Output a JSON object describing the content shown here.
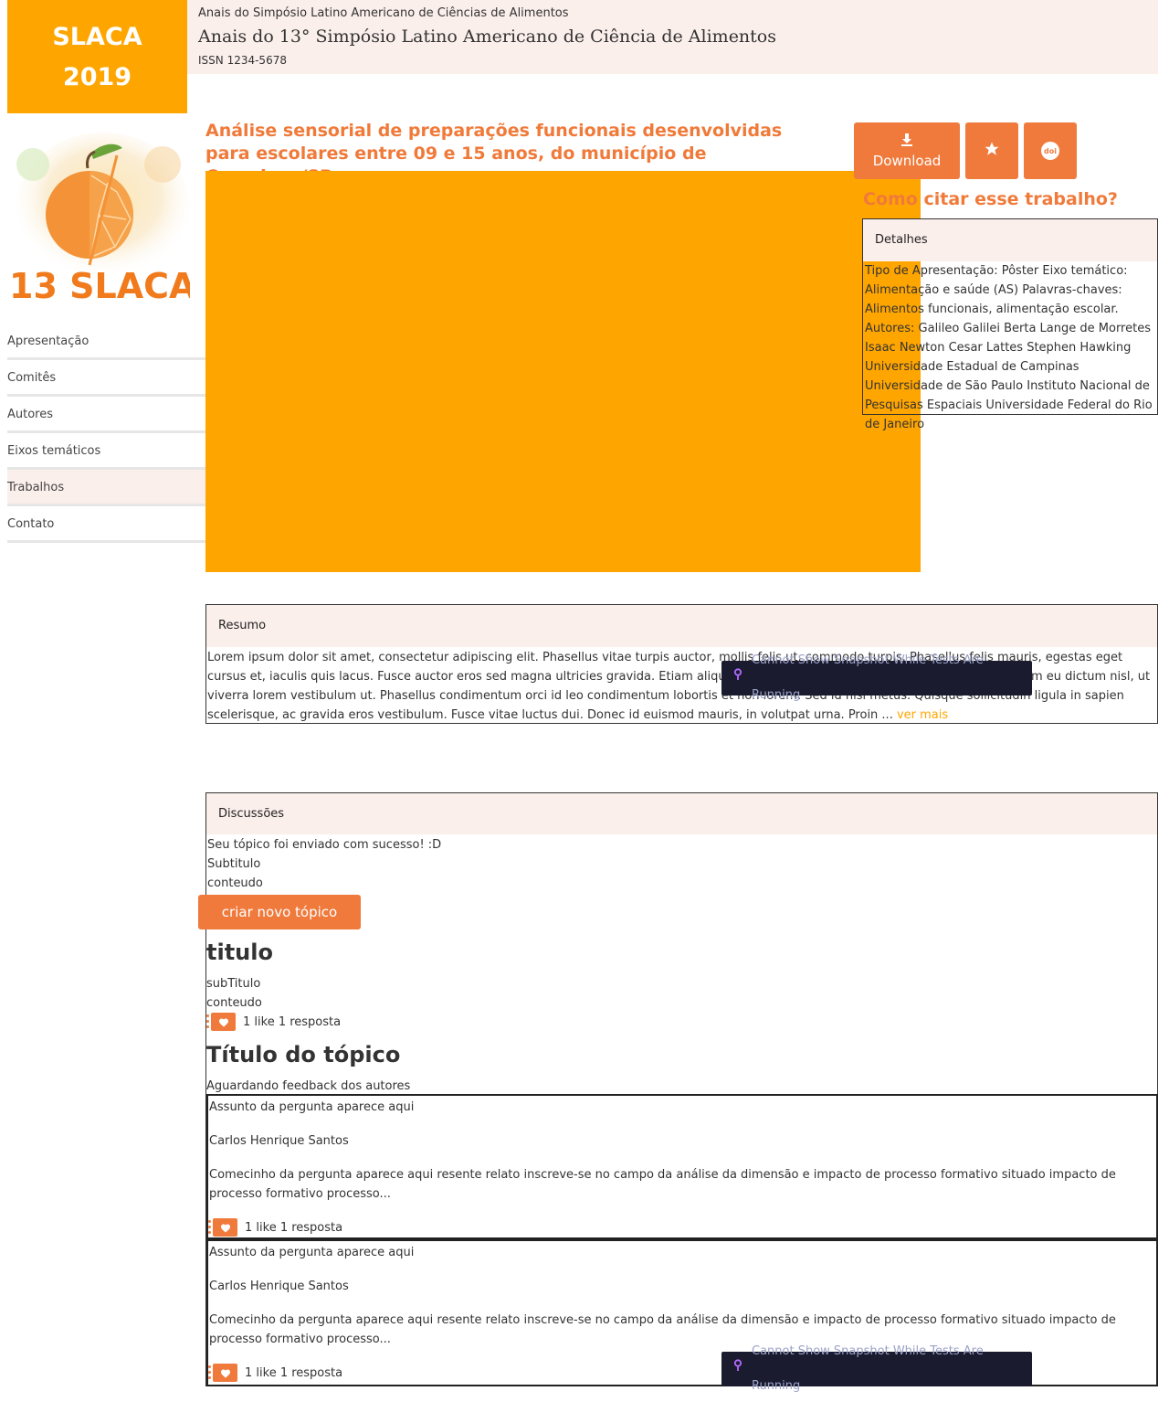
{
  "brand": {
    "line1": "SLACA",
    "line2": "2019"
  },
  "header": {
    "kicker": "Anais do Simpósio Latino Americano de Ciências de Alimentos",
    "title": "Anais do 13° Simpósio Latino Americano de Ciência de Alimentos",
    "issn": "ISSN 1234-5678"
  },
  "logo": {
    "text": "13 SLACA"
  },
  "nav": [
    {
      "label": "Apresentação"
    },
    {
      "label": "Comitês"
    },
    {
      "label": "Autores"
    },
    {
      "label": "Eixos temáticos"
    },
    {
      "label": "Trabalhos",
      "active": true
    },
    {
      "label": "Contato"
    }
  ],
  "work": {
    "title": "Análise sensorial de preparações funcionais desenvolvidas para escolares entre 09 e 15 anos, do município de Campinas/SP"
  },
  "actions": {
    "download": "Download",
    "favorite_icon": "star-icon",
    "doi_label": "doi"
  },
  "cite": "Como citar esse trabalho?",
  "details": {
    "header": "Detalhes",
    "body": "Tipo de Apresentação: Pôster Eixo temático: Alimentação e saúde (AS) Palavras-chaves: Alimentos funcionais, alimentação escolar. Autores: Galileo Galilei Berta Lange de Morretes Isaac Newton Cesar Lattes Stephen Hawking Universidade Estadual de Campinas Universidade de São Paulo Instituto Nacional de Pesquisas Espaciais Universidade Federal do Rio de Janeiro"
  },
  "resumo": {
    "header": "Resumo",
    "body": "Lorem ipsum dolor sit amet, consectetur adipiscing elit. Phasellus vitae turpis auctor, mollis felis ut, commodo turpis. Phasellus felis mauris, egestas eget cursus et, iaculis quis lacus. Fusce auctor eros sed magna ultricies gravida. Etiam aliquam dictum nisl, vel aliquam ligula tincidunt sed. Nam eu dictum nisl, ut viverra lorem vestibulum ut. Phasellus condimentum orci id leo condimentum lobortis et non lorem. Sed id nisi metus. Quisque sollicitudin ligula in sapien scelerisque, ac gravida eros vestibulum. Fusce vitae luctus dui. Donec id euismod mauris, in volutpat urna. Proin ...",
    "more": "ver mais"
  },
  "discussions": {
    "header": "Discussões",
    "success": "Seu tópico foi enviado com sucesso! :D",
    "subtitle": "Subtitulo",
    "content": "conteudo",
    "new_topic": "criar novo tópico",
    "topic1": {
      "title": "titulo",
      "subtitle": "subTitulo",
      "content": "conteudo",
      "stats": "1 like 1 resposta"
    },
    "topic2": {
      "title": "Título do tópico",
      "status": "Aguardando feedback dos autores"
    },
    "questions": [
      {
        "subject": "Assunto da pergunta aparece aqui",
        "author": "Carlos Henrique Santos",
        "excerpt": "Comecinho da pergunta aparece aqui resente relato inscreve-se no campo da análise da dimensão e impacto de processo formativo situado impacto de processo formativo processo...",
        "stats": "1 like 1 resposta"
      },
      {
        "subject": "Assunto da pergunta aparece aqui",
        "author": "Carlos Henrique Santos",
        "excerpt": "Comecinho da pergunta aparece aqui resente relato inscreve-se no campo da análise da dimensão e impacto de processo formativo situado impacto de processo formativo processo...",
        "stats": "1 like 1 resposta"
      }
    ]
  },
  "toast": {
    "text": "Cannot Show Snapshot While Tests Are Running"
  },
  "colors": {
    "accent": "#ef7a3c",
    "brand": "#ffa500",
    "panel_bg": "#fbefeb",
    "toast_bg": "#1b1b2f"
  }
}
